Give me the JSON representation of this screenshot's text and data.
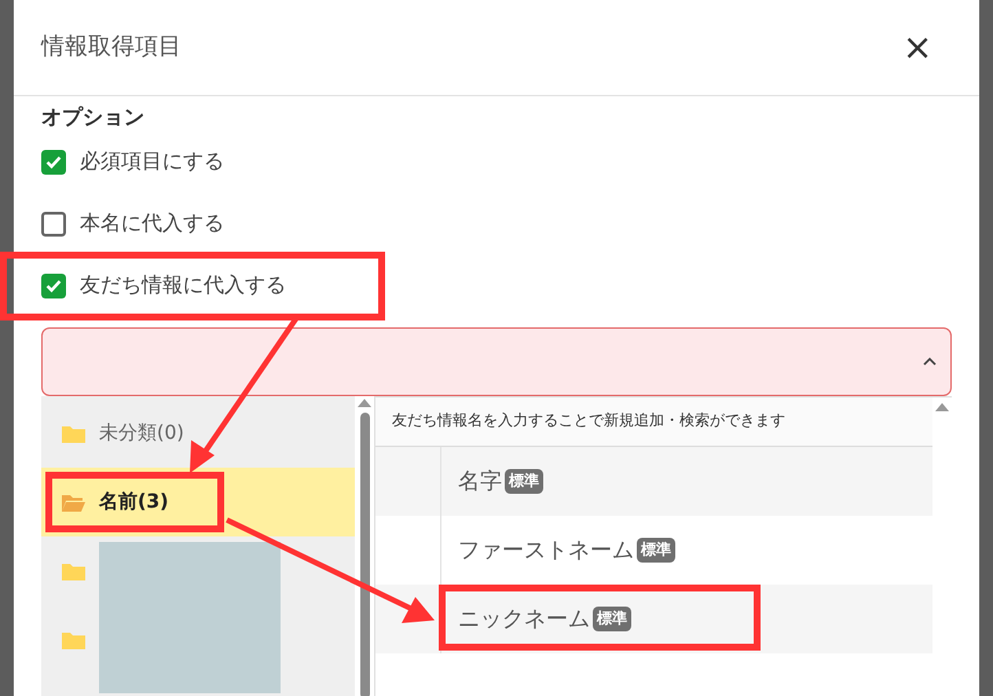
{
  "dialog": {
    "title": "情報取得項目",
    "close": "×"
  },
  "options": {
    "heading": "オプション",
    "items": [
      {
        "label": "必須項目にする",
        "checked": true,
        "highlighted": false
      },
      {
        "label": "本名に代入する",
        "checked": false,
        "highlighted": false
      },
      {
        "label": "友だち情報に代入する",
        "checked": true,
        "highlighted": true
      }
    ]
  },
  "select": {
    "invalid": true,
    "expanded": true
  },
  "folders": [
    {
      "kind": "labeled",
      "label": "未分類(0)",
      "selected": false,
      "highlighted": false
    },
    {
      "kind": "labeled",
      "label": "名前(3)",
      "selected": true,
      "highlighted": true
    },
    {
      "kind": "redacted",
      "selected": false,
      "highlighted": false
    },
    {
      "kind": "redacted",
      "selected": false,
      "highlighted": false
    }
  ],
  "fields": {
    "hint": "友だち情報名を入力することで新規追加・検索ができます",
    "items": [
      {
        "name": "名字",
        "tag": "標準",
        "highlighted": false
      },
      {
        "name": "ファーストネーム",
        "tag": "標準",
        "highlighted": false
      },
      {
        "name": "ニックネーム",
        "tag": "標準",
        "highlighted": true
      }
    ]
  }
}
